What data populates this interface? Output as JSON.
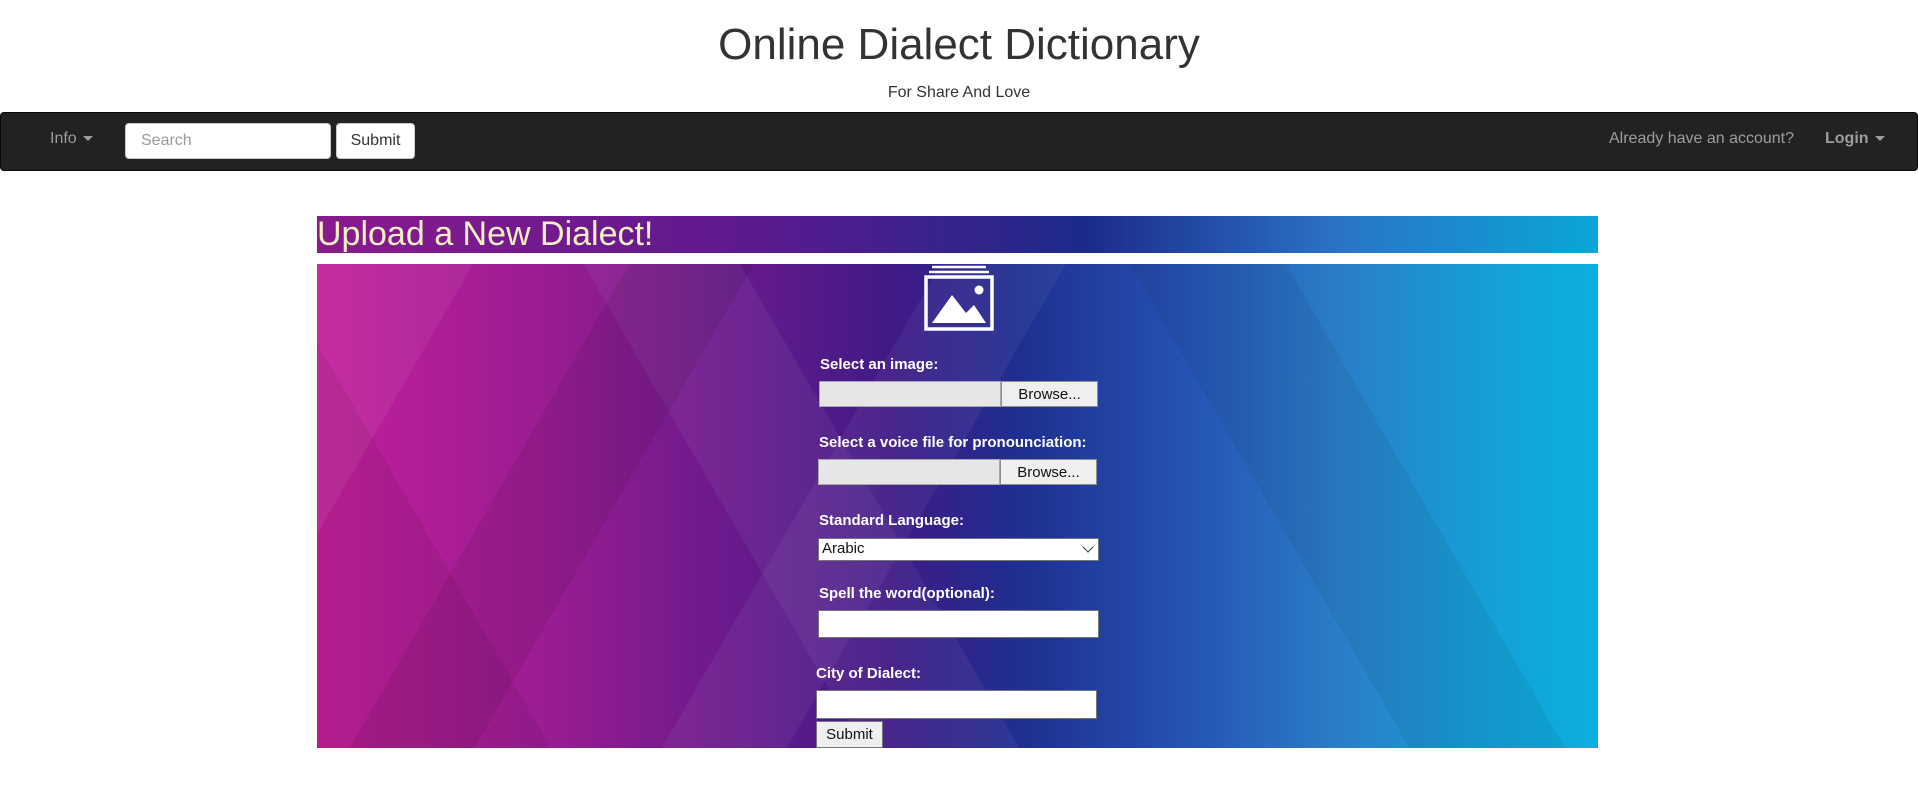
{
  "header": {
    "title": "Online Dialect Dictionary",
    "subtitle": "For Share And Love"
  },
  "navbar": {
    "info_label": "Info",
    "search_placeholder": "Search",
    "search_value": "",
    "submit_label": "Submit",
    "account_text": "Already have an account?",
    "login_label": "Login"
  },
  "upload": {
    "banner_title": "Upload a New Dialect!",
    "image_icon": "image-gallery-icon",
    "image_label": "Select an image:",
    "image_browse": "Browse...",
    "voice_label": "Select a voice file for pronounciation:",
    "voice_browse": "Browse...",
    "language_label": "Standard Language:",
    "language_selected": "Arabic",
    "spell_label": "Spell the word(optional):",
    "spell_value": "",
    "city_label": "City of Dialect:",
    "city_value": "",
    "submit_label": "Submit"
  },
  "colors": {
    "navbar_bg": "#222222",
    "nav_text": "#9d9d9d",
    "banner_text": "#f4eec0",
    "form_label": "#ffffff"
  }
}
